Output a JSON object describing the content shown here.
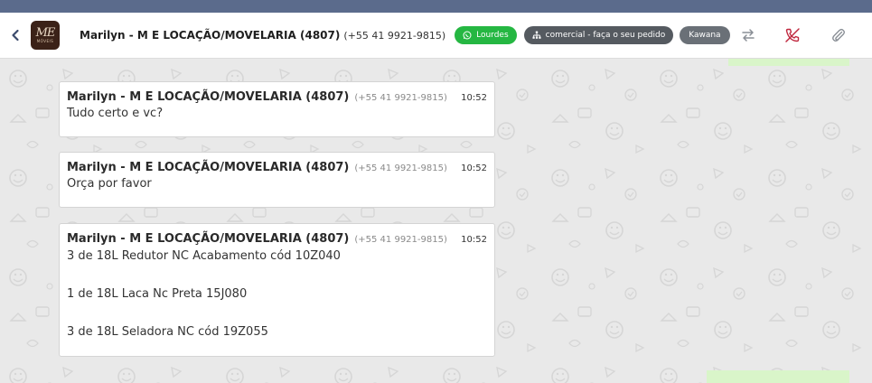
{
  "header": {
    "avatar_monogram": "ME",
    "avatar_sub": "MÓVEIS",
    "contact_name": "Marilyn - M E LOCAÇÃO/MOVELARIA (4807)",
    "contact_phone": "(+55 41 9921-9815)",
    "tags": [
      {
        "label": "Lourdes",
        "icon": "whatsapp-icon",
        "color": "#25b742"
      },
      {
        "label": "comercial - faça o seu pedido",
        "icon": "sitemap-icon",
        "color": "#555a60"
      },
      {
        "label": "Kawana",
        "color": "#6a7077"
      }
    ],
    "actions": [
      {
        "icon": "transfer-icon"
      },
      {
        "icon": "end-call-icon",
        "color": "#c0283f"
      },
      {
        "icon": "paperclip-icon"
      }
    ]
  },
  "messages": [
    {
      "sender": "Marilyn - M E LOCAÇÃO/MOVELARIA (4807)",
      "phone": "(+55 41 9921-9815)",
      "time": "10:52",
      "text": "Tudo certo e vc?"
    },
    {
      "sender": "Marilyn - M E LOCAÇÃO/MOVELARIA (4807)",
      "phone": "(+55 41 9921-9815)",
      "time": "10:52",
      "text": "Orça por favor"
    },
    {
      "sender": "Marilyn - M E LOCAÇÃO/MOVELARIA (4807)",
      "phone": "(+55 41 9921-9815)",
      "time": "10:52",
      "lines": [
        "3 de 18L Redutor NC Acabamento cód 10Z040",
        "1 de 18L Laca Nc Preta 15J080",
        "3 de 18L Seladora NC cód 19Z055"
      ]
    }
  ]
}
